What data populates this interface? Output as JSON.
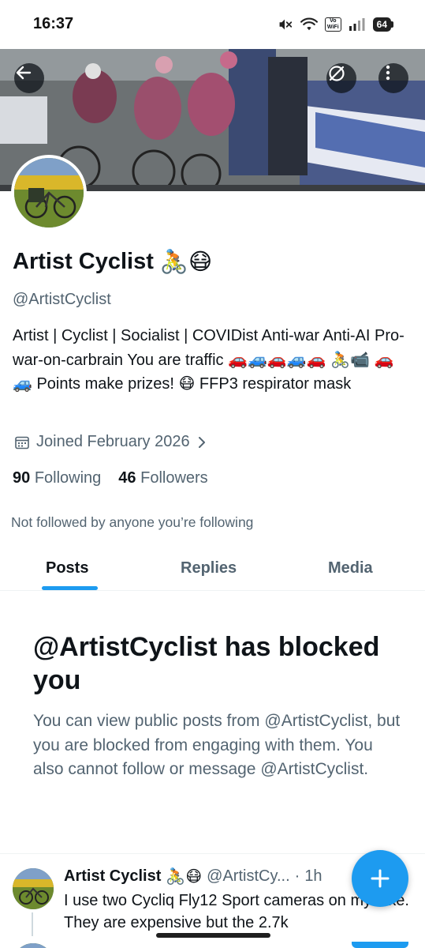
{
  "status_bar": {
    "time": "16:37",
    "vowifi_top": "Vo",
    "vowifi_bottom": "WiFi",
    "battery": "64",
    "icons": [
      "mute-icon",
      "wifi-icon",
      "vowifi-icon",
      "signal-icon",
      "battery-icon"
    ]
  },
  "header": {
    "icons": [
      "back-arrow-icon",
      "share-icon",
      "more-icon"
    ]
  },
  "profile": {
    "name": "Artist Cyclist",
    "name_emojis": "🚴😷",
    "handle": "@ArtistCyclist",
    "bio": "Artist | Cyclist | Socialist | COVIDist   Anti-war Anti-AI Pro-war-on-carbrain You are traffic 🚗🚙🚗🚙🚗 🚴📹 🚗🚙 Points make prizes! 😷 FFP3 respirator mask",
    "joined": "Joined February 2026",
    "following_count": "90",
    "following_label": "Following",
    "followers_count": "46",
    "followers_label": "Followers",
    "not_followed_text": "Not followed by anyone you’re following"
  },
  "tabs": [
    {
      "label": "Posts",
      "active": true
    },
    {
      "label": "Replies",
      "active": false
    },
    {
      "label": "Media",
      "active": false
    }
  ],
  "blocked": {
    "title": "@ArtistCyclist has blocked you",
    "body": "You can view public posts from @ArtistCyclist, but you are blocked from engaging with them. You also cannot follow or message @ArtistCyclist."
  },
  "tweet": {
    "name": "Artist Cyclist",
    "emojis": "🚴😷",
    "handle": "@ArtistCy...",
    "dot": "·",
    "time": "1h",
    "text": "I use two Cycliq Fly12 Sport cameras on my bike. They are expensive but the 2.7k"
  },
  "colors": {
    "accent": "#1d9bf0",
    "text_primary": "#0f1419",
    "text_secondary": "#536471",
    "divider": "#eff3f4"
  },
  "fab": {
    "icon": "plus-icon"
  }
}
